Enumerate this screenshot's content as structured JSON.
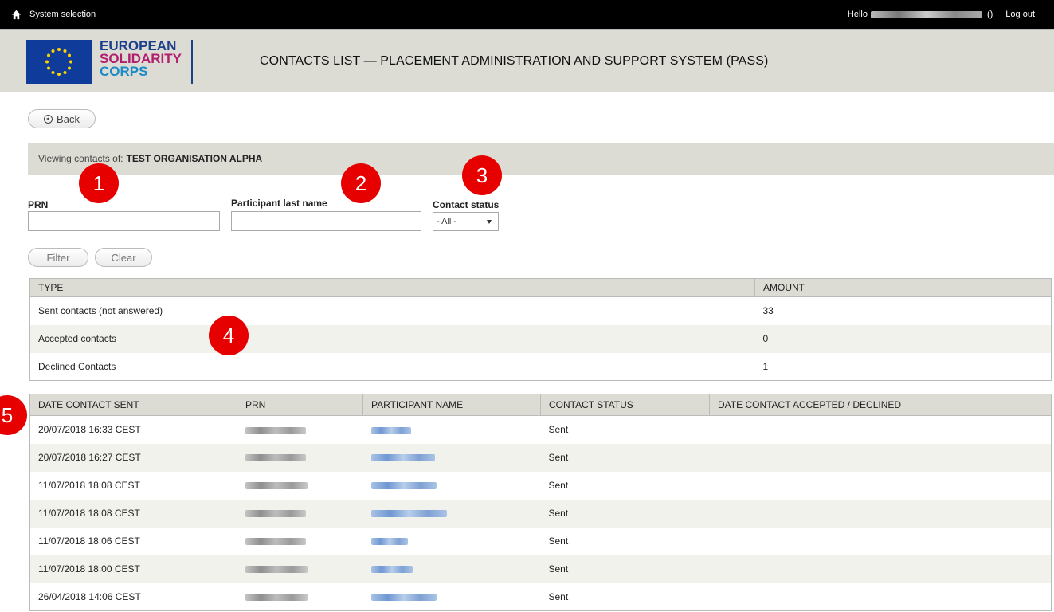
{
  "topbar": {
    "system_selection": "System selection",
    "hello_prefix": "Hello",
    "user_suffix": "()",
    "logout": "Log out"
  },
  "header": {
    "logo_line1": "EUROPEAN",
    "logo_line2": "SOLIDARITY",
    "logo_line3": "CORPS",
    "title": "CONTACTS LIST — PLACEMENT ADMINISTRATION AND SUPPORT SYSTEM (PASS)"
  },
  "back_button": "Back",
  "viewing": {
    "prefix": "Viewing contacts of:",
    "org": "TEST ORGANISATION ALPHA"
  },
  "filters": {
    "prn_label": "PRN",
    "prn_value": "",
    "last_name_label": "Participant last name",
    "last_name_value": "",
    "status_label": "Contact status",
    "status_selected": "- All -",
    "filter_button": "Filter",
    "clear_button": "Clear"
  },
  "summary": {
    "headers": [
      "TYPE",
      "AMOUNT"
    ],
    "rows": [
      {
        "type": "Sent contacts (not answered)",
        "amount": "33"
      },
      {
        "type": "Accepted contacts",
        "amount": "0"
      },
      {
        "type": "Declined Contacts",
        "amount": "1"
      }
    ]
  },
  "contacts": {
    "headers": [
      "DATE CONTACT SENT",
      "PRN",
      "PARTICIPANT NAME",
      "CONTACT STATUS",
      "DATE CONTACT ACCEPTED / DECLINED"
    ],
    "rows": [
      {
        "date": "20/07/2018 16:33 CEST",
        "status": "Sent",
        "accepted": ""
      },
      {
        "date": "20/07/2018 16:27 CEST",
        "status": "Sent",
        "accepted": ""
      },
      {
        "date": "11/07/2018 18:08 CEST",
        "status": "Sent",
        "accepted": ""
      },
      {
        "date": "11/07/2018 18:08 CEST",
        "status": "Sent",
        "accepted": ""
      },
      {
        "date": "11/07/2018 18:06 CEST",
        "status": "Sent",
        "accepted": ""
      },
      {
        "date": "11/07/2018 18:00 CEST",
        "status": "Sent",
        "accepted": ""
      },
      {
        "date": "26/04/2018 14:06 CEST",
        "status": "Sent",
        "accepted": ""
      }
    ]
  },
  "markers": [
    "1",
    "2",
    "3",
    "4",
    "5"
  ]
}
